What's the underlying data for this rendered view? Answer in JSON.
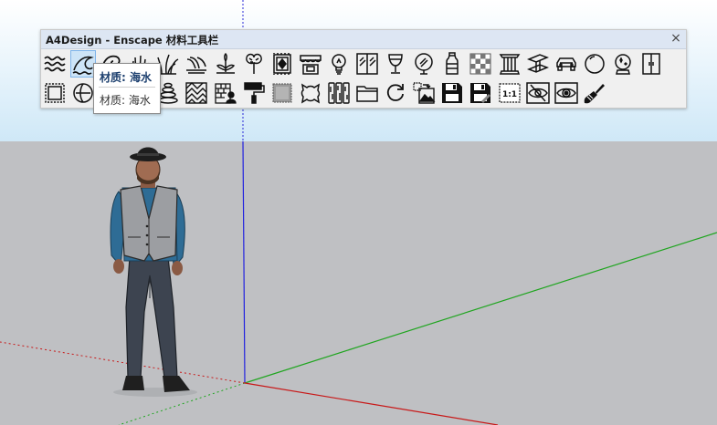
{
  "toolbar": {
    "title": "A4Design - Enscape 材料工具栏",
    "close_glyph": "×",
    "row1_icons": [
      "waves-icon",
      "sea-water-icon",
      "swirl-icon",
      "grass-icon",
      "tall-grass-icon",
      "wheat-grass-icon",
      "plant-tuft-icon",
      "monstera-leaf-icon",
      "rug-icon",
      "awning-icon",
      "lightbulb-icon",
      "glass-window-icon",
      "wine-glass-icon",
      "mirror-icon",
      "plastic-bottle-icon",
      "checkerboard-icon",
      "column-icon",
      "steel-beam-icon",
      "car-icon",
      "sphere-icon",
      "crystal-ball-icon",
      "wardrobe-icon"
    ],
    "row2_icons": [
      "fabric-swatch-icon",
      "chrome-ball-icon",
      "trophy-icon",
      "stone-tiles-icon",
      "pebble-stack-icon",
      "herringbone-icon",
      "brick-wall-person-icon",
      "paint-roller-icon",
      "carpet-swatch-icon",
      "leather-hide-icon",
      "wood-planks-icon",
      "folder-icon",
      "refresh-icon",
      "image-swap-icon",
      "save-disk-icon",
      "save-as-disk-icon",
      "scale-1to1-icon",
      "hide-eye-icon",
      "show-eye-icon",
      "paint-brush-icon"
    ],
    "scale_label": "1:1"
  },
  "tooltip": {
    "title": "材质: 海水",
    "description": "材质: 海水"
  },
  "colors": {
    "sky_top": "#ffffff",
    "sky_bottom": "#cfe8f7",
    "ground": "#bfc0c3",
    "axis_blue": "#2020e0",
    "axis_green": "#1fa51f",
    "axis_red": "#c81818",
    "toolbar_bg": "#f0f0f0",
    "titlebar_bg": "#dde6f3",
    "tooltip_title": "#1c3f6e"
  }
}
